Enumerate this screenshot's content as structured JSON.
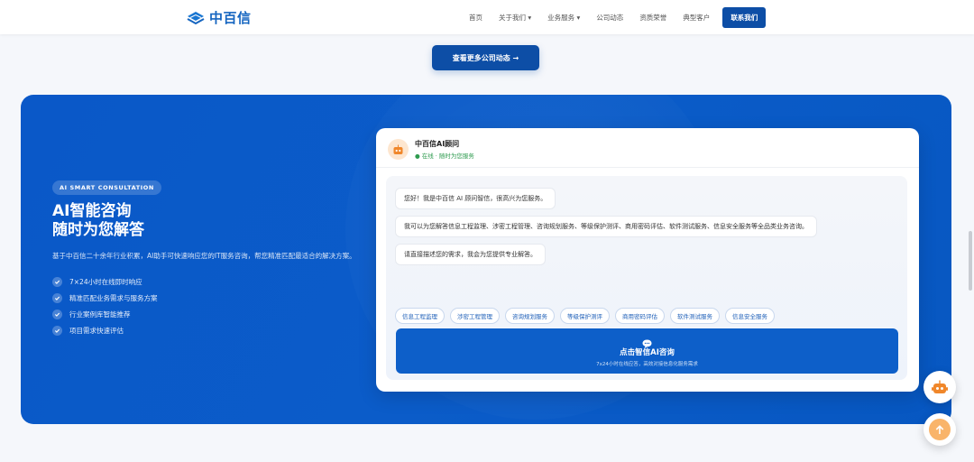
{
  "header": {
    "brand": "中百信",
    "nav": [
      "首页",
      "关于我们 ▾",
      "业务服务 ▾",
      "公司动态",
      "资质荣誉",
      "典型客户"
    ],
    "cta": "联系我们"
  },
  "news": {
    "more_label": "查看更多公司动态 →"
  },
  "consult": {
    "badge": "AI SMART CONSULTATION",
    "title_line1": "AI智能咨询",
    "title_line2": "随时为您解答",
    "description": "基于中百信二十余年行业积累，AI助手可快速响应您的IT服务咨询，帮您精准匹配最适合的解决方案。",
    "features": [
      "7×24小时在线即时响应",
      "精准匹配业务需求与服务方案",
      "行业案例库智能推荐",
      "项目需求快速评估"
    ]
  },
  "chat": {
    "bot_name": "中百信AI顾问",
    "status": "● 在线 · 随时为您服务",
    "messages": [
      "您好！我是中百信 AI 顾问智信，很高兴为您服务。",
      "我可以为您解答信息工程监理、涉密工程管理、咨询规划服务、等级保护测评、商用密码评估、软件测试服务、信息安全服务等全品类业务咨询。",
      "请直接描述您的需求，我会为您提供专业解答。"
    ],
    "chips": [
      "信息工程监理",
      "涉密工程管理",
      "咨询规划服务",
      "等级保护测评",
      "商用密码评估",
      "软件测试服务",
      "信息安全服务"
    ],
    "button_title": "点击智信AI咨询",
    "button_sub": "7x24小时在线应答，高效对接信息化服务需求"
  },
  "colors": {
    "brand": "#0d4ea6",
    "panel": "#0a58c8",
    "accent_orange": "#f9b46a"
  },
  "icons": {
    "bot": "robot-icon",
    "chat": "chat-bubble-icon",
    "check": "check-circle-icon",
    "up": "arrow-up-icon"
  }
}
